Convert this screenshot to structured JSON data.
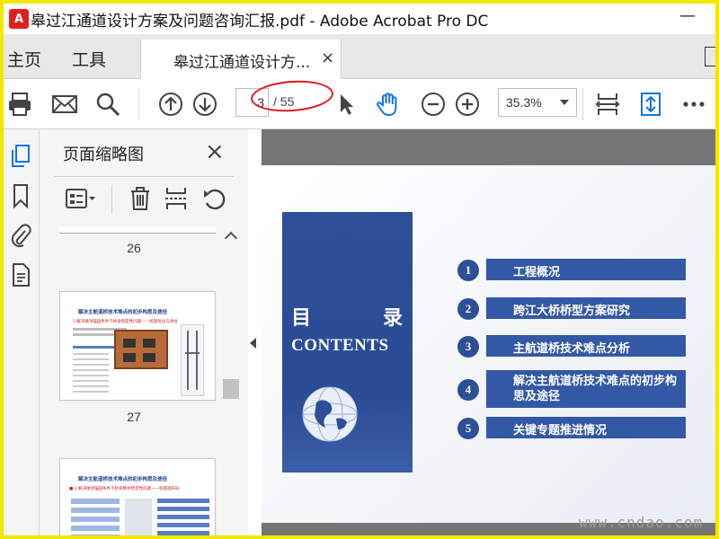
{
  "window": {
    "title": "皋过江通道设计方案及问题咨询汇报.pdf - Adobe Acrobat Pro DC",
    "app_icon": "acrobat-icon",
    "minimize_symbol": "—"
  },
  "tabs": {
    "home": "主页",
    "tools": "工具",
    "document": "皋过江通道设计方...",
    "close_symbol": "×"
  },
  "toolbar": {
    "icons": [
      "print-icon",
      "mail-icon",
      "search-icon",
      "prev-page-icon",
      "next-page-icon",
      "select-cursor-icon",
      "hand-icon",
      "zoom-out-icon",
      "zoom-in-icon",
      "fit-page-icon",
      "scroll-mode-icon",
      "more-icon"
    ],
    "current_page": "3",
    "total_pages": "/ 55",
    "zoom": "35.3%",
    "highlight_color": "#e01818"
  },
  "rail": {
    "icons": [
      "page-thumbnails-icon",
      "bookmark-icon",
      "attachment-icon",
      "document-properties-icon"
    ]
  },
  "thumbnails_panel": {
    "title": "页面缩略图",
    "close_symbol": "×",
    "tools": [
      "page-options-icon",
      "delete-page-icon",
      "insert-page-icon",
      "rotate-page-icon"
    ],
    "pages": [
      {
        "number": "26"
      },
      {
        "number": "27",
        "heading": "解决主航道桥技术难点的初步构思及途径",
        "sub": "1.解决墩顶锚固条件下桥身稳定性问题——桩基优化与承台"
      },
      {
        "heading": "解决主航道桥技术难点的初步构思及途径",
        "sub": "■ 1.解决墩顶锚固条件下桥身整体稳定性问题——桩基础布局"
      }
    ]
  },
  "slide": {
    "title_cn_1": "目",
    "title_cn_2": "录",
    "title_en": "CONTENTS",
    "items": [
      {
        "num": "1",
        "label": "工程概况"
      },
      {
        "num": "2",
        "label": "跨江大桥桥型方案研究"
      },
      {
        "num": "3",
        "label": "主航道桥技术难点分析"
      },
      {
        "num": "4",
        "label": "解决主航道桥技术难点的初步构思及途径"
      },
      {
        "num": "5",
        "label": "关键专题推进情况"
      }
    ],
    "accent_color": "#2c4f98"
  },
  "watermark": "www.cndao.com",
  "colors": {
    "frame_border": "#f3e600",
    "tabbar_bg": "#e8e8e8",
    "icon_blue": "#1473e6",
    "doc_bg": "#757575"
  }
}
